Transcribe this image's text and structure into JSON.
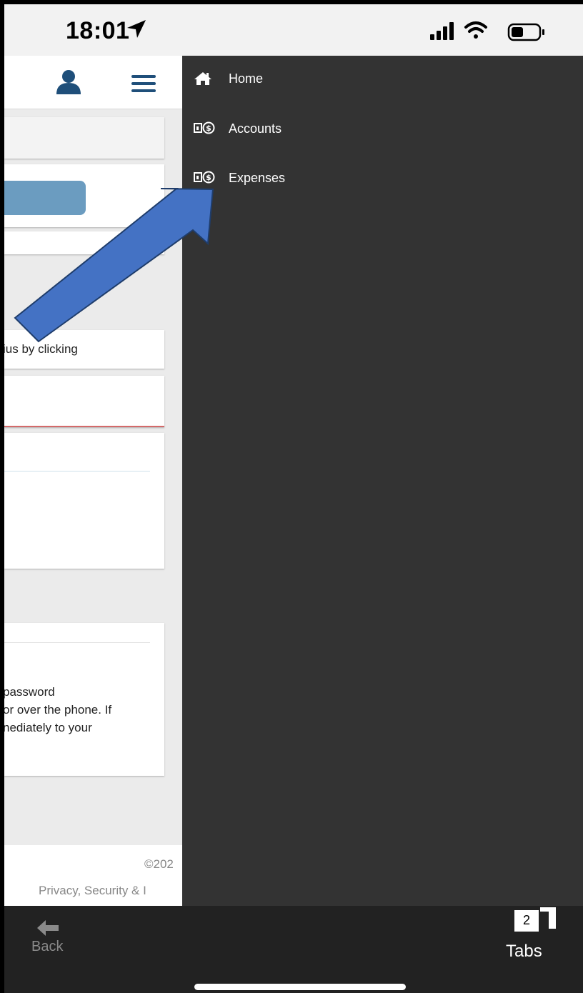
{
  "status_bar": {
    "time": "18:01"
  },
  "page": {
    "notice_fragment": "ius by clicking",
    "warning_lines": [
      "password",
      "or over the phone. If",
      "nediately to your"
    ],
    "footer_copyright": "©202",
    "footer_links": "Privacy, Security & I"
  },
  "drawer": {
    "items": [
      {
        "label": "Home",
        "icon": "home-icon"
      },
      {
        "label": "Accounts",
        "icon": "money-icon"
      },
      {
        "label": "Expenses",
        "icon": "money-icon"
      }
    ]
  },
  "toolbar": {
    "back_label": "Back",
    "tabs_label": "Tabs",
    "tabs_count": "2"
  },
  "colors": {
    "drawer_bg": "#333333",
    "arrow_fill": "#4472c4",
    "header_icon": "#1f4f7a",
    "primary_button": "#6b9cc0",
    "error_underline": "#d46a6a"
  }
}
